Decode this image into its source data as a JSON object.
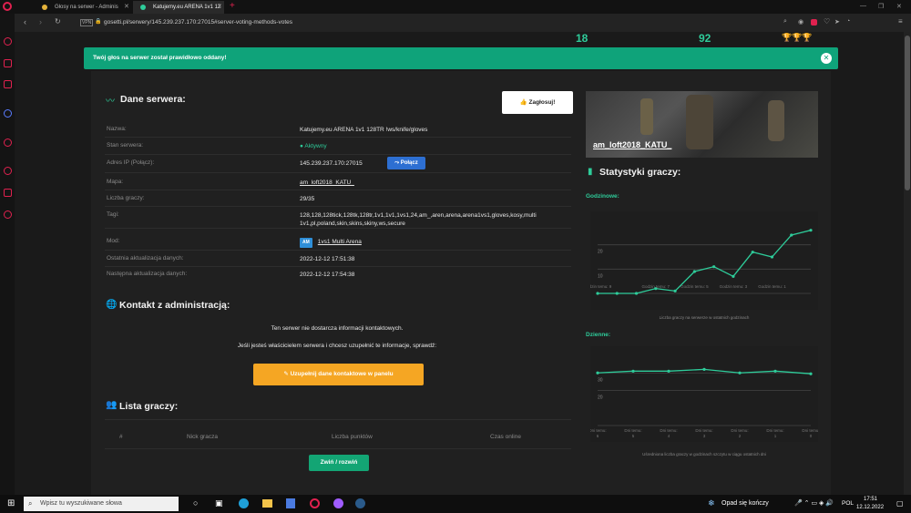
{
  "browser": {
    "tabs": [
      {
        "title": "Głosy na serwer - Adminis",
        "active": false
      },
      {
        "title": "Katujemy.eu ARENA 1v1 12",
        "active": true
      }
    ],
    "url": "gosetti.pl/serwery/145.239.237.170:27015#server-voting-methods-votes",
    "vpn_label": "VPN"
  },
  "top_stats": {
    "a": "18",
    "b": "92"
  },
  "alert": {
    "text": "Twój głos na serwer został prawidłowo oddany!",
    "color": "#0fa37a"
  },
  "server": {
    "title": "Dane serwera:",
    "vote_button": "Zagłosuj!",
    "rows": [
      {
        "label": "Nazwa:",
        "value": "Katujemy.eu ARENA 1v1 128TR !ws/knife/gloves"
      },
      {
        "label": "Stan serwera:",
        "value": "Aktywny"
      },
      {
        "label": "Adres IP (Połącz):",
        "value": "145.239.237.170:27015"
      },
      {
        "label": "Mapa:",
        "value": "am_loft2018_KATU_"
      },
      {
        "label": "Liczba graczy:",
        "value": "29/35"
      },
      {
        "label": "Tagi:",
        "value": "128,128,128tick,128tk,128tr,1v1,1v1,1vs1,24,am_,aren,arena,arena1vs1,gloves,kosy,multi 1v1,pl,poland,skin,skins,skiny,ws,secure"
      },
      {
        "label": "Mod:",
        "value": "1vs1 Multi Arena"
      },
      {
        "label": "Ostatnia aktualizacja danych:",
        "value": "2022-12-12 17:51:38"
      },
      {
        "label": "Następna aktualizacja danych:",
        "value": "2022-12-12 17:54:38"
      }
    ],
    "connect_button": "Połącz",
    "mod_badge": "AM"
  },
  "contact": {
    "title": "Kontakt z administracją:",
    "line1": "Ten serwer nie dostarcza informacji kontaktowych.",
    "line2": "Jeśli jesteś właścicielem serwera i chcesz uzupełnić te informacje, sprawdź:",
    "button": "Uzupełnij dane kontaktowe w panelu"
  },
  "players": {
    "title": "Lista graczy:",
    "columns": [
      "#",
      "Nick gracza",
      "Liczba punktów",
      "Czas online"
    ],
    "toggle_button": "Zwiń / rozwiń"
  },
  "side": {
    "map_name": "am_loft2018_KATU_",
    "stats_title": "Statystyki graczy:",
    "hourly_label": "Godzinowe:",
    "hourly_caption": "Liczba graczy na serwerze w ostatnich godzinach",
    "daily_label": "Dzienne:",
    "daily_caption": "Uśredniona liczba graczy w godzinach szczytu w ciągu ostatnich dni"
  },
  "chart_data": [
    {
      "type": "line",
      "x": [
        "Godzin temu: 9",
        "",
        "",
        "Godzin temu: 7",
        "",
        "Godzin temu: 5",
        "",
        "Godzin temu: 3",
        "",
        "Godzin temu: 1",
        "",
        ""
      ],
      "values": [
        0,
        0,
        0,
        2,
        1,
        9,
        11,
        7,
        17,
        15,
        24,
        26
      ],
      "y_ticks": [
        "10",
        "20"
      ],
      "ylim": [
        0,
        30
      ],
      "color": "#2ecc9a"
    },
    {
      "type": "line",
      "x": [
        "Dni temu: 6",
        "Dni temu: 5",
        "Dni temu: 4",
        "Dni temu: 3",
        "Dni temu: 2",
        "Dni temu: 1",
        "Dni temu: 0"
      ],
      "values": [
        30,
        31,
        31,
        32,
        30,
        31,
        29.5
      ],
      "y_ticks": [
        "20",
        "30"
      ],
      "ylim": [
        0,
        40
      ],
      "color": "#2ecc9a"
    }
  ],
  "taskbar": {
    "search_placeholder": "Wpisz tu wyszukiwane słowa",
    "weather": "Opad się kończy",
    "lang": "POL",
    "time": "17:51",
    "date": "12.12.2022"
  }
}
